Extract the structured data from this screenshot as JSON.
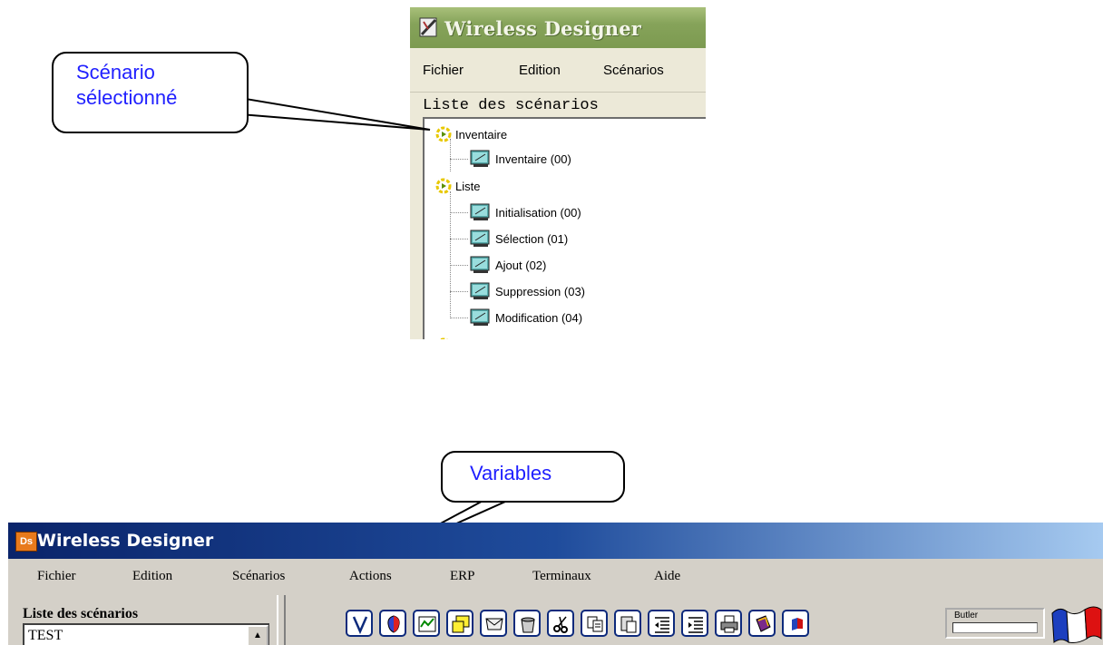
{
  "top": {
    "title": "Wireless Designer",
    "menu": [
      "Fichier",
      "Edition",
      "Scénarios"
    ],
    "list_label": "Liste des scénarios",
    "tree": [
      {
        "label": "Inventaire",
        "children": [
          "Inventaire (00)"
        ]
      },
      {
        "label": "Liste",
        "children": [
          "Initialisation (00)",
          "Sélection (01)",
          "Ajout (02)",
          "Suppression (03)",
          "Modification (04)"
        ]
      }
    ]
  },
  "callouts": {
    "scenario": [
      "Scénario",
      "sélectionné"
    ],
    "variables": "Variables"
  },
  "bottom": {
    "title": "Wireless Designer",
    "app_icon": "Ds",
    "menu": [
      "Fichier",
      "Edition",
      "Scénarios",
      "Actions",
      "ERP",
      "Terminaux",
      "Aide"
    ],
    "list_label": "Liste des scénarios",
    "first_item": "TEST",
    "toolbar_icons": [
      "variables-icon",
      "shield-icon",
      "chart-icon",
      "frames-icon",
      "envelope-icon",
      "bucket-icon",
      "scissors-icon",
      "copy-icon",
      "paste-icon",
      "indent-left-icon",
      "indent-right-icon",
      "print-icon",
      "book-icon",
      "flag-pin-icon"
    ],
    "butler_label": "Butler"
  },
  "colors": {
    "callout_text": "#1f1fff",
    "bottom_title_bg": "#0a246a",
    "top_title_bg": "#86a35a"
  }
}
